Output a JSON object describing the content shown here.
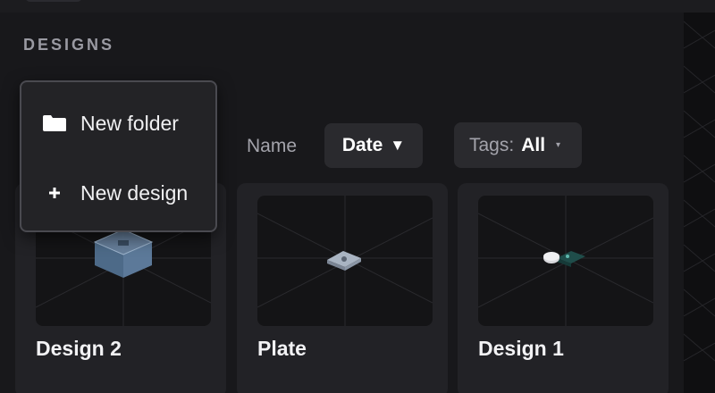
{
  "header": {
    "section_title": "DESIGNS"
  },
  "context_menu": {
    "items": [
      {
        "label": "New folder",
        "icon": "folder-icon"
      },
      {
        "label": "New design",
        "icon": "plus-icon"
      }
    ]
  },
  "sort": {
    "name_label": "Name",
    "date_label": "Date",
    "date_direction": "▼",
    "tags_label": "Tags:",
    "tags_value": "All",
    "tags_caret": "▾"
  },
  "designs": [
    {
      "title": "Design 2",
      "thumbnail": "blue-box-model"
    },
    {
      "title": "Plate",
      "thumbnail": "flat-plate-model"
    },
    {
      "title": "Design 1",
      "thumbnail": "disc-and-board-model"
    }
  ],
  "colors": {
    "background": "#141416",
    "panel": "#18181b",
    "card": "#222226",
    "button": "#2a2a2e",
    "menu_border": "#4a4a50"
  }
}
